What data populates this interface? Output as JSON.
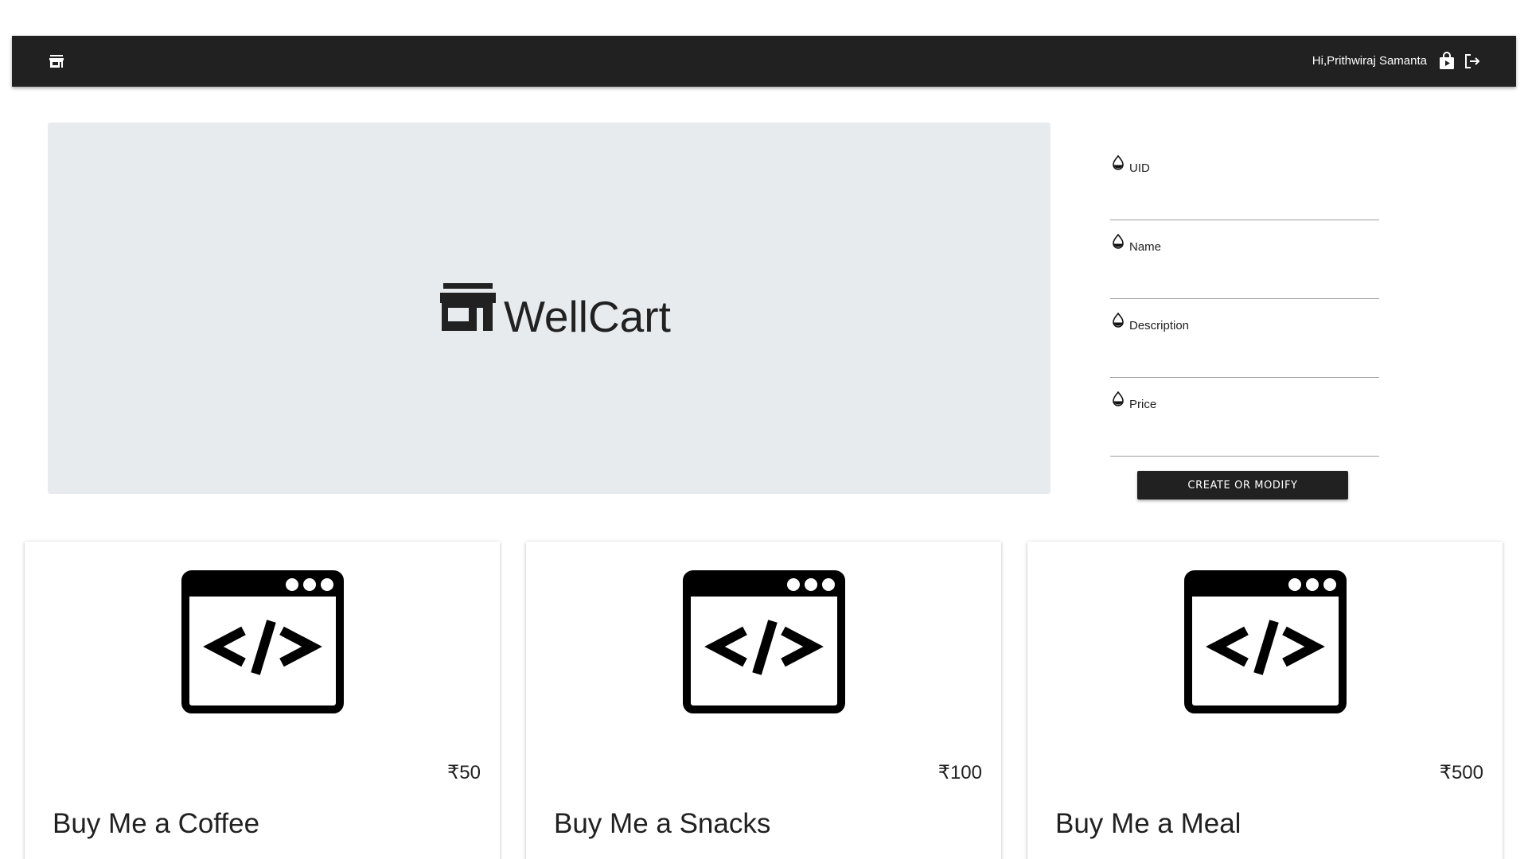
{
  "navbar": {
    "brand_icon": "store-icon",
    "greeting": "Hi,Prithwiraj Samanta",
    "icons": [
      "shopping-bag-icon",
      "logout-icon"
    ]
  },
  "hero": {
    "logo_icon": "store-icon",
    "title": "WellCart"
  },
  "form": {
    "fields": [
      {
        "label": "UID",
        "value": "",
        "icon": "drop-icon"
      },
      {
        "label": "Name",
        "value": "",
        "icon": "drop-icon"
      },
      {
        "label": "Description",
        "value": "",
        "icon": "drop-icon"
      },
      {
        "label": "Price",
        "value": "",
        "icon": "drop-icon"
      }
    ],
    "submit_label": "CREATE OR MODIFY"
  },
  "cards": [
    {
      "price": "₹50",
      "title": "Buy Me a Coffee",
      "icon": "code-window-icon"
    },
    {
      "price": "₹100",
      "title": "Buy Me a Snacks",
      "icon": "code-window-icon"
    },
    {
      "price": "₹500",
      "title": "Buy Me a Meal",
      "icon": "code-window-icon"
    }
  ],
  "colors": {
    "navbar_bg": "#212121",
    "hero_bg": "#e8ebee",
    "button_bg": "#212121",
    "text": "#212121"
  }
}
